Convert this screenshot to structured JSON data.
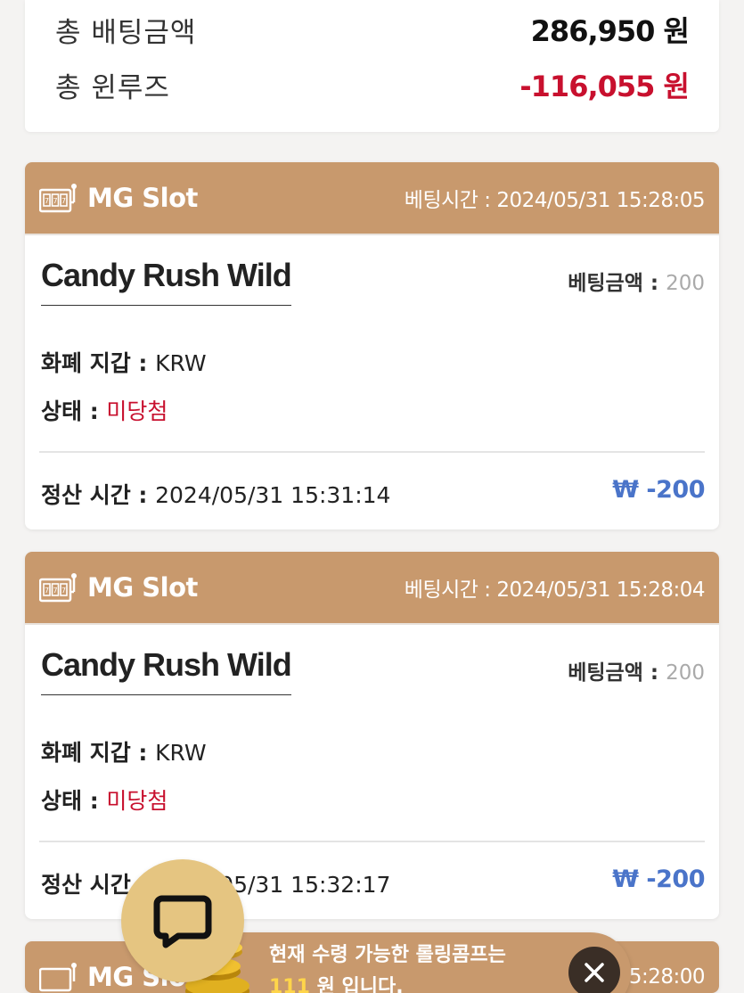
{
  "summary": {
    "total_bet_label": "총 배팅금액",
    "total_bet_value": "286,950 원",
    "total_winloss_label": "총 윈루즈",
    "total_winloss_value": "-116,055 원"
  },
  "bets": [
    {
      "provider": "MG Slot",
      "bet_time_label": "베팅시간 :",
      "bet_time": "2024/05/31 15:28:05",
      "game": "Candy Rush Wild",
      "bet_amount_label": "베팅금액 :",
      "bet_amount": "200",
      "currency_label": "화폐 지갑 :",
      "currency": "KRW",
      "status_label": "상태 :",
      "status": "미당첨",
      "settle_label": "정산 시간 :",
      "settle_time": "2024/05/31 15:31:14",
      "payout": "₩ -200"
    },
    {
      "provider": "MG Slot",
      "bet_time_label": "베팅시간 :",
      "bet_time": "2024/05/31 15:28:04",
      "game": "Candy Rush Wild",
      "bet_amount_label": "베팅금액 :",
      "bet_amount": "200",
      "currency_label": "화폐 지갑 :",
      "currency": "KRW",
      "status_label": "상태 :",
      "status": "미당첨",
      "settle_label": "정산 시간 :",
      "settle_time": "2024/05/31 15:32:17",
      "payout": "₩ -200"
    },
    {
      "provider": "MG Slot",
      "bet_time": "15:28:00"
    }
  ],
  "toast": {
    "line1": "현재 수령 가능한 롤링콤프는",
    "amount": "111",
    "line2": " 원 입니다."
  },
  "colors": {
    "header_bg": "#c8996d",
    "loss_red": "#c8102e",
    "payout_blue": "#4a74c9",
    "chat_bg": "#e5c581"
  },
  "icons": {
    "slot": "slot-machine-icon",
    "chat": "chat-bubble-icon",
    "coins": "coins-icon",
    "close": "close-icon"
  }
}
